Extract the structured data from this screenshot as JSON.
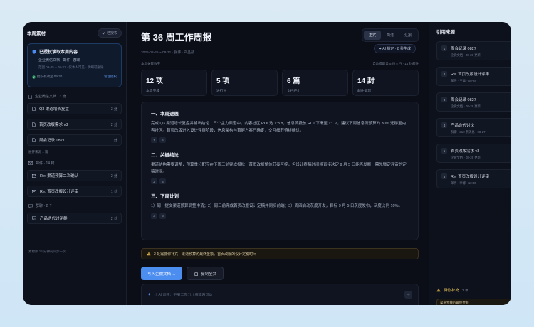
{
  "left": {
    "title": "本周素材",
    "done_label": "已授权",
    "auth": {
      "title": "已授权读取本周内容",
      "sub": "企业微信文档 · 邮件 · 群聊",
      "meta": "范围 09-25 ~ 08-31 · 仅本人可见 · 明细可删除",
      "valid": "授权有效至 09-30",
      "manage": "管理授权"
    },
    "docs_label": "企业微信文档 · 3 篇",
    "docs": [
      {
        "name": "Q3 渠道增长复盘",
        "count": "3 处"
      },
      {
        "name": "首页改版需求 v3",
        "count": "2 处"
      },
      {
        "name": "周会记录 0827",
        "count": "1 处"
      }
    ],
    "cat_small": "展开来源 1 篇",
    "mail_label": "邮件 · 14 封",
    "mails": [
      {
        "name": "Re: 渠道预算二次确认",
        "count": "2 处"
      },
      {
        "name": "Re: 首页改版设计评审",
        "count": "1 处"
      }
    ],
    "chat_label": "群聊 · 2 个",
    "chats": [
      {
        "name": "产品迭代讨论群",
        "count": "2 处"
      }
    ],
    "foot": "素材库 15 分钟前同步一次"
  },
  "main": {
    "title": "第 36 周工作周报",
    "tabs": [
      "正式",
      "简洁",
      "汇报"
    ],
    "ai_badge": "AI 拟定 · 8 秒生成",
    "meta": "2026-08-25 ~ 08-31 · 张伟 · 产品部",
    "stats_label": "本周关键数字",
    "stats_right": "自动提取自 5 份文档 · 14 封邮件",
    "stats": [
      {
        "value": "12 项",
        "label": "本周完成"
      },
      {
        "value": "5 项",
        "label": "进行中"
      },
      {
        "value": "6 篇",
        "label": "文档产出"
      },
      {
        "value": "14 封",
        "label": "邮件处理"
      }
    ],
    "sections": [
      {
        "heading": "一、本周进展",
        "body": "完成 Q3 渠道增长复盘并输出结论：三个主力渠道中，内容社区 ROI 达 1:3.8，信息流投放 ROI 下滑至 1:1.2，建议下周信息流预算的 30% 迁移至内容社区。首页改版进入设计评审阶段，信息架构与首屏方案已确定，交互细节待终确认。",
        "refs": [
          "1",
          "5"
        ]
      },
      {
        "heading": "二、关键结论",
        "body": "渠道结构需要调整，预算重分配应在下周三前完成报批；首页改版整体节奏可控，但设计终稿时间将直接决定 9 月 5 日能否发版，需先锁定评审的定稿时间。",
        "refs": [
          "2",
          "4"
        ]
      },
      {
        "heading": "三、下周计划",
        "body": "1）周一提交渠道预算调整申请；2）周三前完成首页改版设计定稿并同步前端；3）周四启动灰度开发，目标 9 月 5 日灰度发布，灰度比例 10%。",
        "refs": [
          "3",
          "6"
        ]
      }
    ],
    "warning": "2 处需要你补充：渠道预算的最终金额、首页改版的设计定稿时间",
    "primary_btn": "写入企微文档 →",
    "secondary_btn": "复制全文",
    "prompt_placeholder": "让 AI 调整：把第二部分压缩成两句话"
  },
  "right": {
    "title": "引用来源",
    "cites": [
      {
        "n": "1",
        "title": "周会记录 0827",
        "sub": "企微文档 · 08-28 更新"
      },
      {
        "n": "2",
        "title": "Re: 首页改版设计评审",
        "sub": "邮件 · 王磊 · 08-28"
      },
      {
        "n": "3",
        "title": "周会记录 0827",
        "sub": "企微文档 · 08-28 更新"
      },
      {
        "n": "4",
        "title": "产品迭代讨论",
        "sub": "群聊 · 310 条消息 · 08-27"
      },
      {
        "n": "5",
        "title": "首页改版需求 v3",
        "sub": "企微文档 · 08-26 更新"
      },
      {
        "n": "6",
        "title": "Re: 首页改版设计评审",
        "sub": "邮件 · 李娜 · 10:30"
      }
    ],
    "pending_label": "待你补充",
    "pending_count": "2 项",
    "pending_card": "渠道预算的最终金额"
  }
}
